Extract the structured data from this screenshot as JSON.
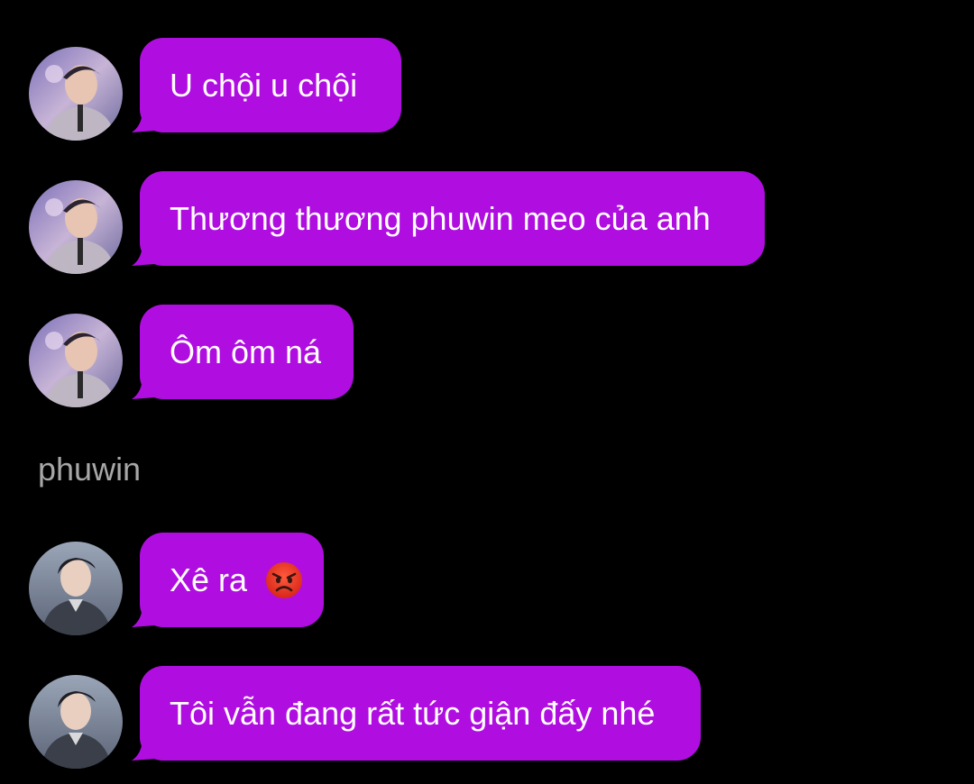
{
  "conversation": {
    "group1_messages": [
      {
        "text": "U chội u chội"
      },
      {
        "text": "Thương thương phuwin meo của anh"
      },
      {
        "text": "Ôm ôm ná"
      }
    ],
    "sender_name": "phuwin",
    "group2_messages": [
      {
        "text": "Xê ra",
        "emoji": "angry-face-icon"
      },
      {
        "text": "Tôi vẫn đang rất tức giận đấy nhé"
      }
    ]
  },
  "colors": {
    "background": "#000000",
    "bubble": "#b00ee0",
    "bubble_text": "#ffffff",
    "sender_name": "#a7a7a7"
  }
}
